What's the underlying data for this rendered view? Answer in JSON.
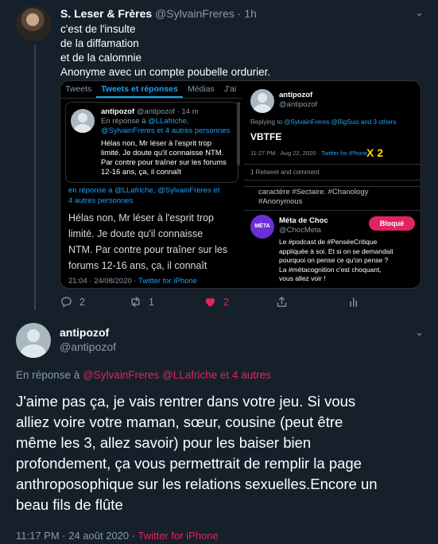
{
  "parent": {
    "name": "S. Leser & Frères",
    "handle": "@SylvainFreres",
    "sep": "·",
    "time": "1h",
    "lines": [
      "c'est de l'insulte",
      "de la diffamation",
      "et de la calomnie",
      "Anonyme avec un compte poubelle ordurier."
    ],
    "actions": {
      "reply_count": "2",
      "retweet_count": "1",
      "like_count": "2"
    }
  },
  "media": {
    "tabs": [
      "Tweets",
      "Tweets et réponses",
      "Médias",
      "J'ai"
    ],
    "left": {
      "name": "antipozof",
      "handle": "@antipozof · 14 m",
      "reply_prefix": "En réponse à",
      "reply_targets_1": "@LLafriche,",
      "reply_targets_2": "@SylvainFreres et 4 autres personnes",
      "small_lines": [
        "Hélas non, Mr léser à l'esprit trop",
        "limité. Je doute qu'il connaisse NTM.",
        "Par contre pour traîner sur les forums",
        "12-16 ans, ça, il connaît"
      ],
      "cut_line_1": "en réponse à @LLafriche, @SylvainFreres et",
      "cut_line_2": "4 autres personnes",
      "big_lines": [
        "Hélas non, Mr léser à l'esprit trop",
        "limité. Je doute qu'il connaisse",
        "NTM. Par contre pour traîner sur les",
        "forums 12-16 ans, ça, il connaît"
      ],
      "footer_time": "21:04 · 24/08/2020 ·",
      "footer_source": "Twitter for iPhone"
    },
    "right": {
      "name": "antipozof",
      "handle": "@antipozof",
      "replying": "Replying to",
      "replying_targets": "@SylvainFreres @BigSuis and 3 others",
      "text": "VBTFE",
      "meta": "11:27 PM · Aug 22, 2020 ·",
      "meta_source": "Twitter for iPhone",
      "overlay": "X  2",
      "retweet_line": "1 Retweet and comment",
      "hashtag_line_1": "caractère #Sectaire. #Chanology",
      "hashtag_line_2": "#Anonymous",
      "card_name": "Méta de Choc",
      "card_handle": "@ChocMeta",
      "logo_text": "MÉTA",
      "blocked": "Bloqué",
      "card_lines": [
        "Le #podcast de #PenséeCritique",
        "appliquée à soi. Et si on se demandait",
        "pourquoi on pense ce qu'on pense ?",
        "La #métacognition c'est choquant,",
        "vous allez voir !"
      ]
    }
  },
  "reply": {
    "name": "antipozof",
    "handle": "@antipozof",
    "in_reply_to": "En réponse à",
    "targets": "@SylvainFreres @LLafriche  et 4 autres",
    "lines": [
      "J'aime pas ça, je vais rentrer dans votre jeu. Si vous",
      "alliez voire votre maman, sœur, cousine (peut être",
      "même les 3, allez savoir) pour les baiser bien",
      "profondement, ça vous permettrait de remplir la page",
      "anthroposophique sur les relations sexuelles.Encore un",
      "beau fils de flûte"
    ],
    "timestamp": "11:17 PM · 24 août 2020 ·",
    "source": "Twitter for iPhone"
  },
  "colors": {
    "background": "#15202b",
    "accent": "#1da1f2",
    "like": "#e0245e",
    "muted": "#8899a6"
  }
}
